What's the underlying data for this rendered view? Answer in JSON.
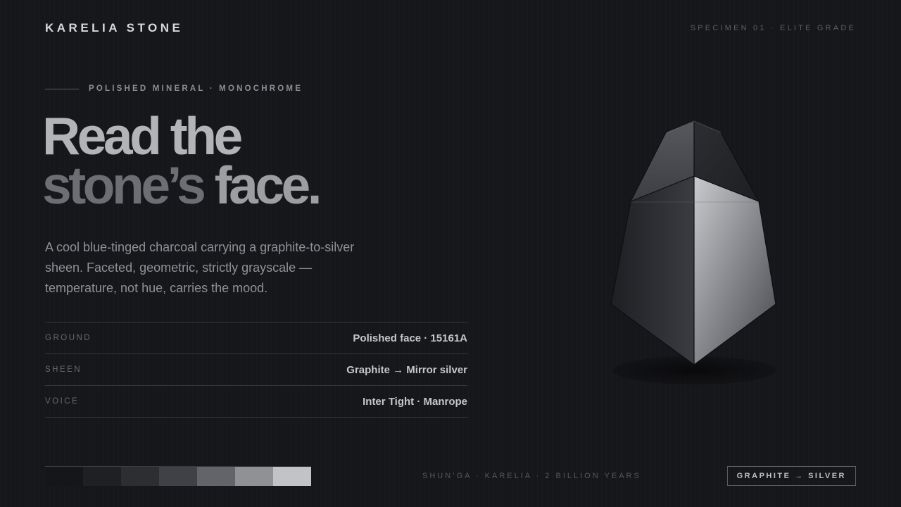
{
  "header": {
    "brand": "KARELIA STONE",
    "specimen": "SPECIMEN 01 · ELITE GRADE"
  },
  "hero": {
    "eyebrow": "POLISHED MINERAL · MONOCHROME",
    "headline_line1": "Read the",
    "headline_line2a": "stone’s",
    "headline_line2b": "face.",
    "lede": "A cool blue-tinged charcoal carrying a graphite-to-silver sheen. Faceted, geometric, strictly grayscale — temperature, not hue, carries the mood."
  },
  "specs": [
    {
      "key": "GROUND",
      "value": "Polished face · 15161A"
    },
    {
      "key": "SHEEN",
      "value": "Graphite → Mirror silver"
    },
    {
      "key": "VOICE",
      "value": "Inter Tight · Manrope"
    }
  ],
  "swatches": [
    "#15161a",
    "#1f2024",
    "#2d2e32",
    "#3f4146",
    "#62646a",
    "#8f9195",
    "#c2c3c6"
  ],
  "footer": {
    "note": "SHUN’GA · KARELIA · 2 BILLION YEARS",
    "badge": "GRAPHITE → SILVER"
  },
  "icons": {
    "stone": "faceted-stone-illustration"
  }
}
